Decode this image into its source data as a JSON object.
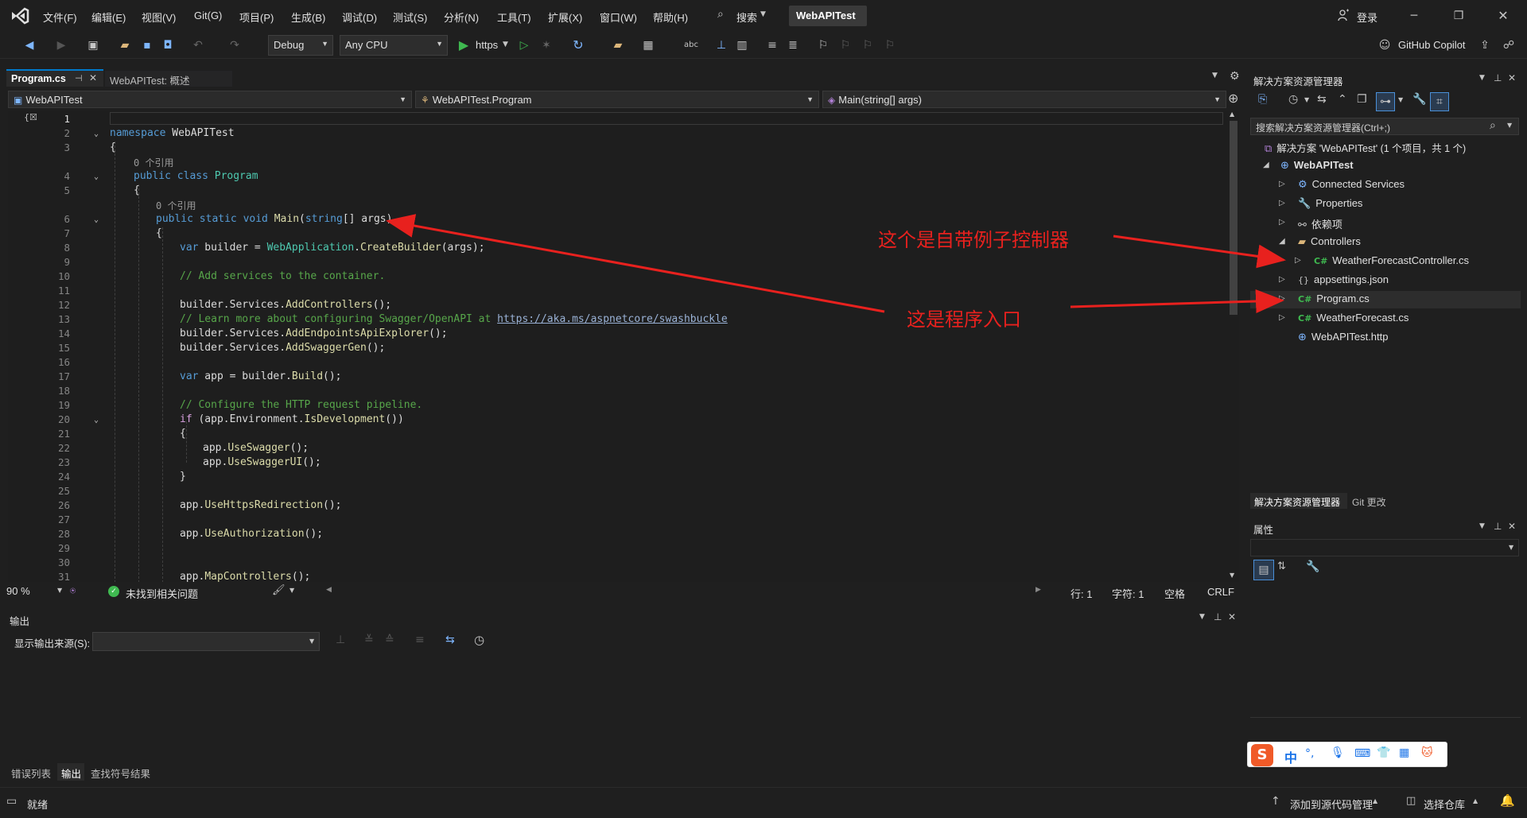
{
  "menubar": {
    "items": [
      "文件(F)",
      "编辑(E)",
      "视图(V)",
      "Git(G)",
      "项目(P)",
      "生成(B)",
      "调试(D)",
      "测试(S)",
      "分析(N)",
      "工具(T)",
      "扩展(X)",
      "窗口(W)",
      "帮助(H)"
    ],
    "search_label": "搜索",
    "solution_name": "WebAPITest",
    "login": "登录"
  },
  "toolbar": {
    "config": "Debug",
    "platform": "Any CPU",
    "run_target": "https",
    "copilot": "GitHub Copilot"
  },
  "tabs": [
    {
      "label": "Program.cs",
      "active": true
    },
    {
      "label": "WebAPITest: 概述",
      "active": false
    }
  ],
  "navbar": {
    "project": "WebAPITest",
    "type": "WebAPITest.Program",
    "member": "Main(string[] args)"
  },
  "code": {
    "line_numbers": [
      "1",
      "2",
      "3",
      "4",
      "5",
      "6",
      "7",
      "8",
      "9",
      "10",
      "11",
      "12",
      "13",
      "14",
      "15",
      "16",
      "17",
      "18",
      "19",
      "20",
      "21",
      "22",
      "23",
      "24",
      "25",
      "26",
      "27",
      "28",
      "29",
      "30",
      "31"
    ],
    "ref0": "0 个引用",
    "ns_kw": "namespace",
    "ns_name": "WebAPITest",
    "cls_kw": "public class",
    "cls_name": "Program",
    "main_kw": "public static void",
    "main_name": "Main",
    "main_args_kw": "string",
    "main_args": "[] args)",
    "l8_var": "var",
    "l8_a": " builder = ",
    "l8_ty": "WebApplication",
    "l8_b": ".",
    "l8_m": "CreateBuilder",
    "l8_c": "(args);",
    "l10": "// Add services to the container.",
    "l12_a": "builder.Services.",
    "l12_m": "AddControllers",
    "l12_b": "();",
    "l13_a": "// Learn more about configuring Swagger/OpenAPI at ",
    "l13_url": "https://aka.ms/aspnetcore/swashbuckle",
    "l14_a": "builder.Services.",
    "l14_m": "AddEndpointsApiExplorer",
    "l14_b": "();",
    "l15_a": "builder.Services.",
    "l15_m": "AddSwaggerGen",
    "l15_b": "();",
    "l17_var": "var",
    "l17_a": " app = builder.",
    "l17_m": "Build",
    "l17_b": "();",
    "l19": "// Configure the HTTP request pipeline.",
    "l20_kw": "if",
    "l20_a": " (app.Environment.",
    "l20_m": "IsDevelopment",
    "l20_b": "())",
    "l22_a": "app.",
    "l22_m": "UseSwagger",
    "l22_b": "();",
    "l23_a": "app.",
    "l23_m": "UseSwaggerUI",
    "l23_b": "();",
    "l26_a": "app.",
    "l26_m": "UseHttpsRedirection",
    "l26_b": "();",
    "l28_a": "app.",
    "l28_m": "UseAuthorization",
    "l28_b": "();",
    "l31_a": "app.",
    "l31_m": "MapControllers",
    "l31_b": "();"
  },
  "editor_status": {
    "zoom": "90 %",
    "issues": "未找到相关问题",
    "line": "行: 1",
    "char": "字符: 1",
    "spacing": "空格",
    "eol": "CRLF"
  },
  "output": {
    "title": "输出",
    "source_label": "显示输出来源(S):"
  },
  "bottom_tabs": [
    "错误列表",
    "输出",
    "查找符号结果"
  ],
  "status": {
    "ready": "就绪",
    "add_source": "添加到源代码管理",
    "select_repo": "选择仓库"
  },
  "solution_explorer": {
    "title": "解决方案资源管理器",
    "search_placeholder": "搜索解决方案资源管理器(Ctrl+;)",
    "solution": "解决方案 'WebAPITest' (1 个项目，共 1 个)",
    "project": "WebAPITest",
    "items": [
      "Connected Services",
      "Properties",
      "依赖项",
      "Controllers",
      "WeatherForecastController.cs",
      "appsettings.json",
      "Program.cs",
      "WeatherForecast.cs",
      "WebAPITest.http"
    ],
    "tab_solution": "解决方案资源管理器",
    "tab_git": "Git 更改"
  },
  "properties": {
    "title": "属性"
  },
  "annotations": {
    "controller_note": "这个是自带例子控制器",
    "entry_note": "这是程序入口"
  },
  "ime": {
    "chinese": "中"
  },
  "colors": {
    "accent": "#007acc",
    "annotation_red": "#e8211e"
  }
}
